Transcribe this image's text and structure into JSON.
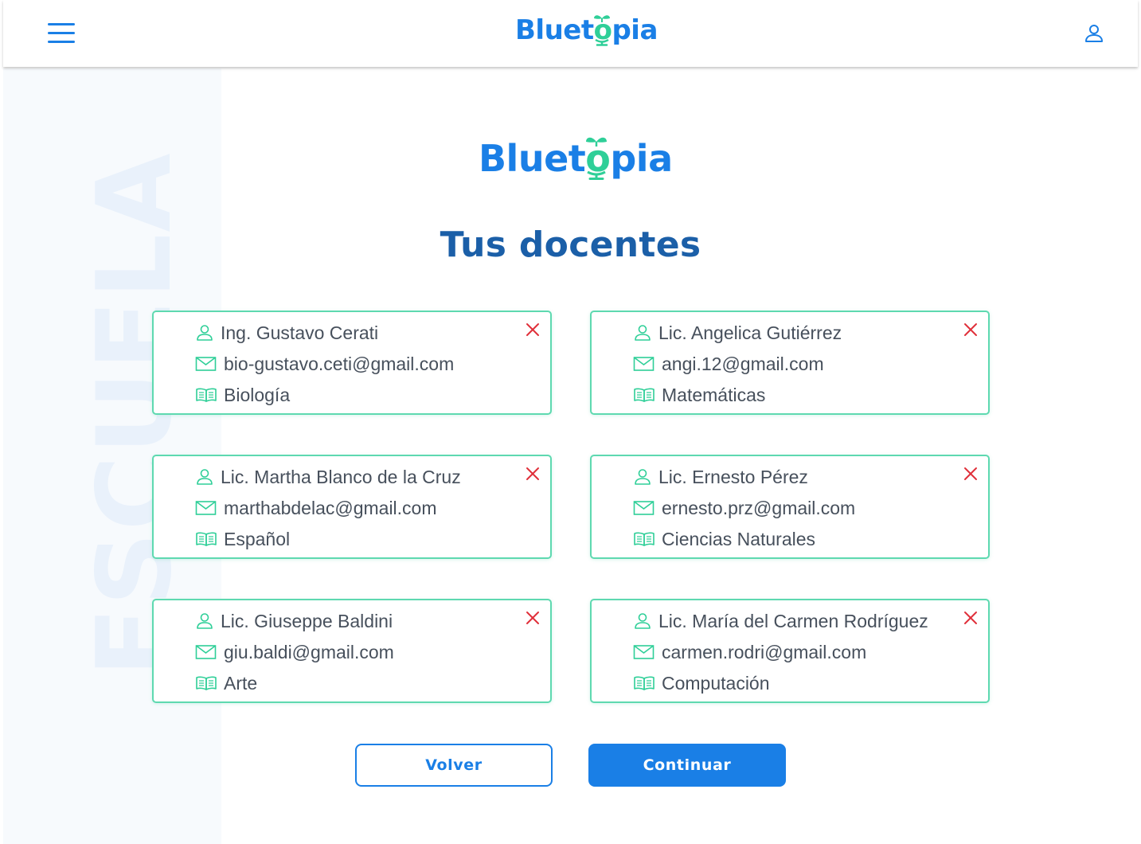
{
  "header": {
    "logo": {
      "before": "Bluet",
      "o": "o",
      "after": "pia"
    }
  },
  "brand": {
    "logo": {
      "before": "Bluet",
      "o": "o",
      "after": "pia"
    }
  },
  "side": {
    "watermark": "ESCUELA"
  },
  "main": {
    "title": "Tus docentes",
    "teachers": [
      {
        "name": "Ing. Gustavo Cerati",
        "email": "bio-gustavo.ceti@gmail.com",
        "subject": "Biología"
      },
      {
        "name": "Lic. Angelica Gutiérrez",
        "email": "angi.12@gmail.com",
        "subject": "Matemáticas"
      },
      {
        "name": "Lic. Martha Blanco de la Cruz",
        "email": "marthabdelac@gmail.com",
        "subject": "Español"
      },
      {
        "name": "Lic. Ernesto Pérez",
        "email": "ernesto.prz@gmail.com",
        "subject": "Ciencias Naturales"
      },
      {
        "name": "Lic. Giuseppe Baldini",
        "email": "giu.baldi@gmail.com",
        "subject": "Arte"
      },
      {
        "name": "Lic. María del Carmen Rodríguez",
        "email": "carmen.rodri@gmail.com",
        "subject": "Computación"
      }
    ]
  },
  "actions": {
    "back_label": "Volver",
    "continue_label": "Continuar"
  },
  "icons": {
    "menu": "hamburger-menu-icon",
    "account": "user-icon",
    "name": "user-icon",
    "email": "envelope-icon",
    "subject": "open-book-icon",
    "remove": "close-icon"
  },
  "colors": {
    "brand_blue": "#1a7fe6",
    "title_blue": "#1b5fa8",
    "accent_green": "#2fcf98",
    "card_border": "#5ed9b0",
    "remove_red": "#e0303a",
    "text": "#47505c"
  }
}
